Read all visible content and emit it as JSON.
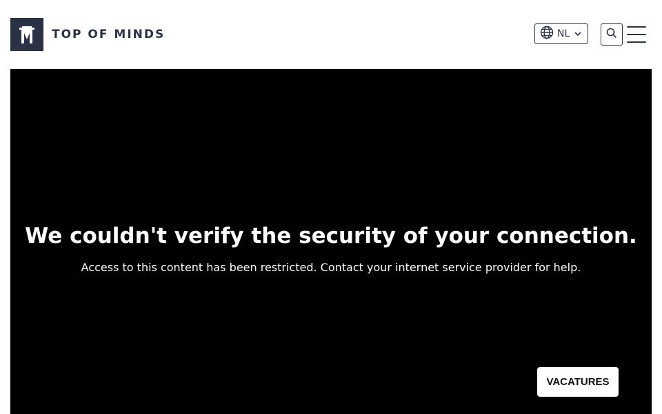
{
  "header": {
    "logo_text": "TOP OF MINDS",
    "logo_icon": "m-monogram-logo",
    "language": {
      "code": "NL",
      "icon": "globe-icon",
      "chevron": "chevron-down-icon"
    },
    "search_icon": "search-icon",
    "menu_icon": "hamburger-menu-icon"
  },
  "hero": {
    "title": "We couldn't verify the security of your connection.",
    "subtitle": "Access to this content has been restricted. Contact your internet service provider for help.",
    "cta_label": "VACATURES"
  },
  "colors": {
    "brand": "#2b3245",
    "hero_background": "#000000",
    "page_background": "#ffffff"
  }
}
